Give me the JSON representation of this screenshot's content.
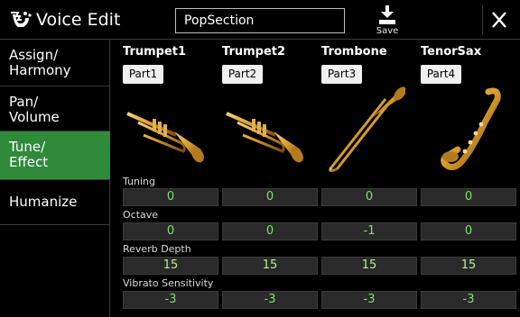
{
  "header": {
    "title": "Voice Edit",
    "name_value": "PopSection",
    "save_label": "Save"
  },
  "sidebar": {
    "items": [
      {
        "label": "Assign/\nHarmony"
      },
      {
        "label": "Pan/\nVolume"
      },
      {
        "label": "Tune/\nEffect"
      },
      {
        "label": "Humanize"
      }
    ],
    "active_index": 2
  },
  "instruments": [
    {
      "name": "Trumpet1",
      "part": "Part1",
      "icon": "trumpet-icon"
    },
    {
      "name": "Trumpet2",
      "part": "Part2",
      "icon": "trumpet-icon"
    },
    {
      "name": "Trombone",
      "part": "Part3",
      "icon": "trombone-icon"
    },
    {
      "name": "TenorSax",
      "part": "Part4",
      "icon": "saxophone-icon"
    }
  ],
  "params": [
    {
      "label": "Tuning",
      "values": [
        "0",
        "0",
        "0",
        "0"
      ]
    },
    {
      "label": "Octave",
      "values": [
        "0",
        "0",
        "-1",
        "0"
      ]
    },
    {
      "label": "Reverb Depth",
      "values": [
        "15",
        "15",
        "15",
        "15"
      ]
    },
    {
      "label": "Vibrato Sensitivity",
      "values": [
        "-3",
        "-3",
        "-3",
        "-3"
      ]
    }
  ],
  "colors": {
    "active_tab": "#2f8a3a",
    "value_text": "#7ee06e",
    "brass": "#d59a2a"
  }
}
